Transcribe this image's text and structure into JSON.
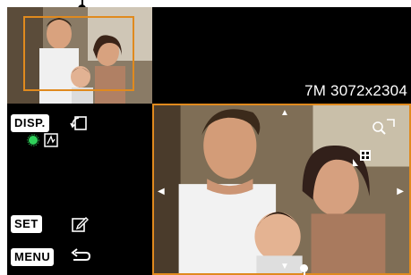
{
  "image_info": {
    "size_label": "7M 3072x2304"
  },
  "controls": {
    "disp_label": "DISP.",
    "set_label": "SET",
    "menu_label": "MENU"
  },
  "icons": {
    "rotate": "rotate-icon",
    "face_select": "face-select-icon",
    "edit": "edit-icon",
    "back": "back-arrow-icon",
    "zoom": "zoom-icon",
    "status_dot": "green-dot-icon"
  },
  "colors": {
    "frame_accent": "#e08a1e",
    "status_green": "#2fd05a"
  }
}
